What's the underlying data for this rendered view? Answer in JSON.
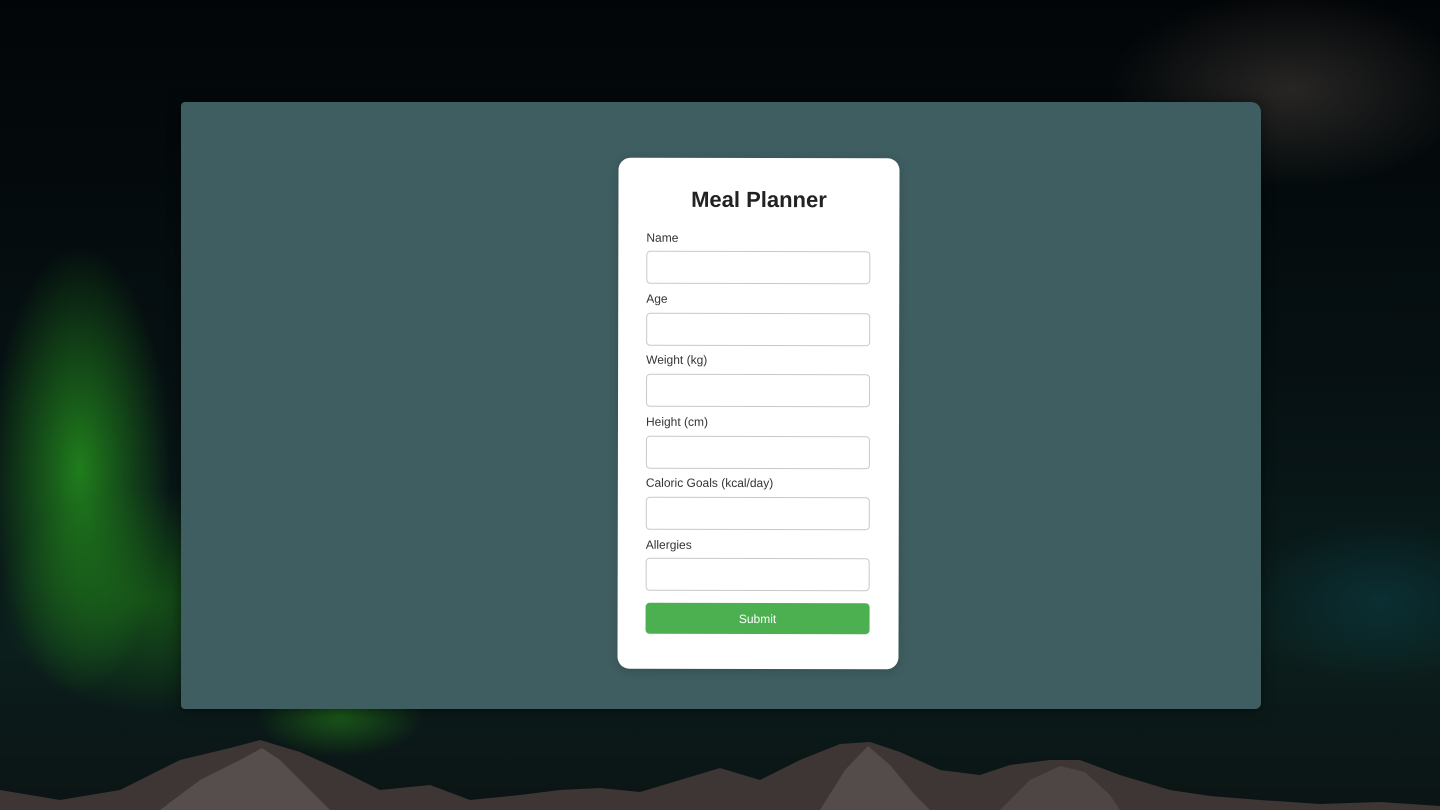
{
  "form": {
    "title": "Meal Planner",
    "fields": [
      {
        "label": "Name",
        "value": "",
        "placeholder": ""
      },
      {
        "label": "Age",
        "value": "",
        "placeholder": ""
      },
      {
        "label": "Weight (kg)",
        "value": "",
        "placeholder": ""
      },
      {
        "label": "Height (cm)",
        "value": "",
        "placeholder": ""
      },
      {
        "label": "Caloric Goals (kcal/day)",
        "value": "",
        "placeholder": ""
      },
      {
        "label": "Allergies",
        "value": "",
        "placeholder": ""
      }
    ],
    "submit_label": "Submit"
  },
  "colors": {
    "window_background": "#3f5e61",
    "card_background": "#ffffff",
    "submit_button": "#4caf50"
  }
}
